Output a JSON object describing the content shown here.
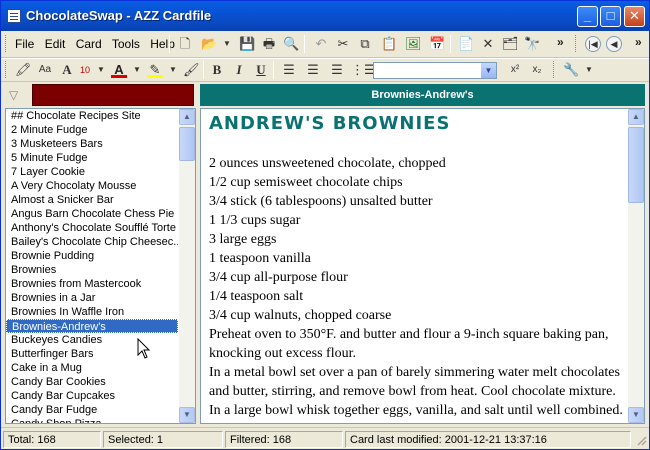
{
  "window": {
    "title": "ChocolateSwap - AZZ Cardfile",
    "minimize": "_",
    "maximize": "□",
    "close": "✕"
  },
  "menu": [
    "File",
    "Edit",
    "Card",
    "Tools",
    "Help"
  ],
  "toolbar": {
    "font_size": "10",
    "bold": "B",
    "italic": "I",
    "underline": "U",
    "superscript": "x²",
    "subscript": "x₂",
    "font_name": "",
    "overflow": "»"
  },
  "filter": {
    "value": "",
    "card_header": "Brownies-Andrew's"
  },
  "list": {
    "items": [
      "## Chocolate Recipes Site",
      "2 Minute Fudge",
      "3 Musketeers Bars",
      "5 Minute Fudge",
      "7 Layer Cookie",
      "A Very Chocolaty Mousse",
      "Almost a Snicker Bar",
      "Angus Barn Chocolate Chess Pie",
      "Anthony's Chocolate Soufflé Torte",
      "Bailey's Chocolate Chip Cheesec...",
      "Brownie Pudding",
      "Brownies",
      "Brownies from Mastercook",
      "Brownies in a Jar",
      "Brownies In Waffle Iron",
      "Brownies-Andrew's",
      "Buckeyes Candies",
      "Butterfinger Bars",
      "Cake in a Mug",
      "Candy Bar Cookies",
      "Candy Bar Cupcakes",
      "Candy Bar Fudge",
      "Candy Shop Pizza"
    ],
    "selected_index": 15
  },
  "card": {
    "title": "ANDREW'S BROWNIES",
    "lines": [
      "2 ounces unsweetened chocolate, chopped",
      "1/2 cup semisweet chocolate chips",
      "3/4 stick (6 tablespoons) unsalted butter",
      "1 1/3 cups sugar",
      "3 large eggs",
      "1 teaspoon vanilla",
      "3/4 cup all-purpose flour",
      "1/4 teaspoon salt",
      "3/4 cup walnuts, chopped coarse",
      "Preheat oven to 350°F. and butter and flour a 9-inch square baking pan, knocking out excess flour.",
      "In a metal bowl set over a pan of barely simmering water melt chocolates and butter, stirring, and remove bowl from heat. Cool chocolate mixture.",
      "In a large bowl whisk together eggs, vanilla, and salt until well combined."
    ]
  },
  "status": {
    "total": "Total: 168",
    "selected": "Selected: 1",
    "filtered": "Filtered: 168",
    "modified": "Card last modified: 2001-12-21  13:37:16"
  },
  "colors": {
    "titlebar": "#0854d8",
    "filter_box": "#7d0000",
    "card_header": "#0b7272",
    "card_title": "#0b7272",
    "selection": "#316ac5"
  }
}
